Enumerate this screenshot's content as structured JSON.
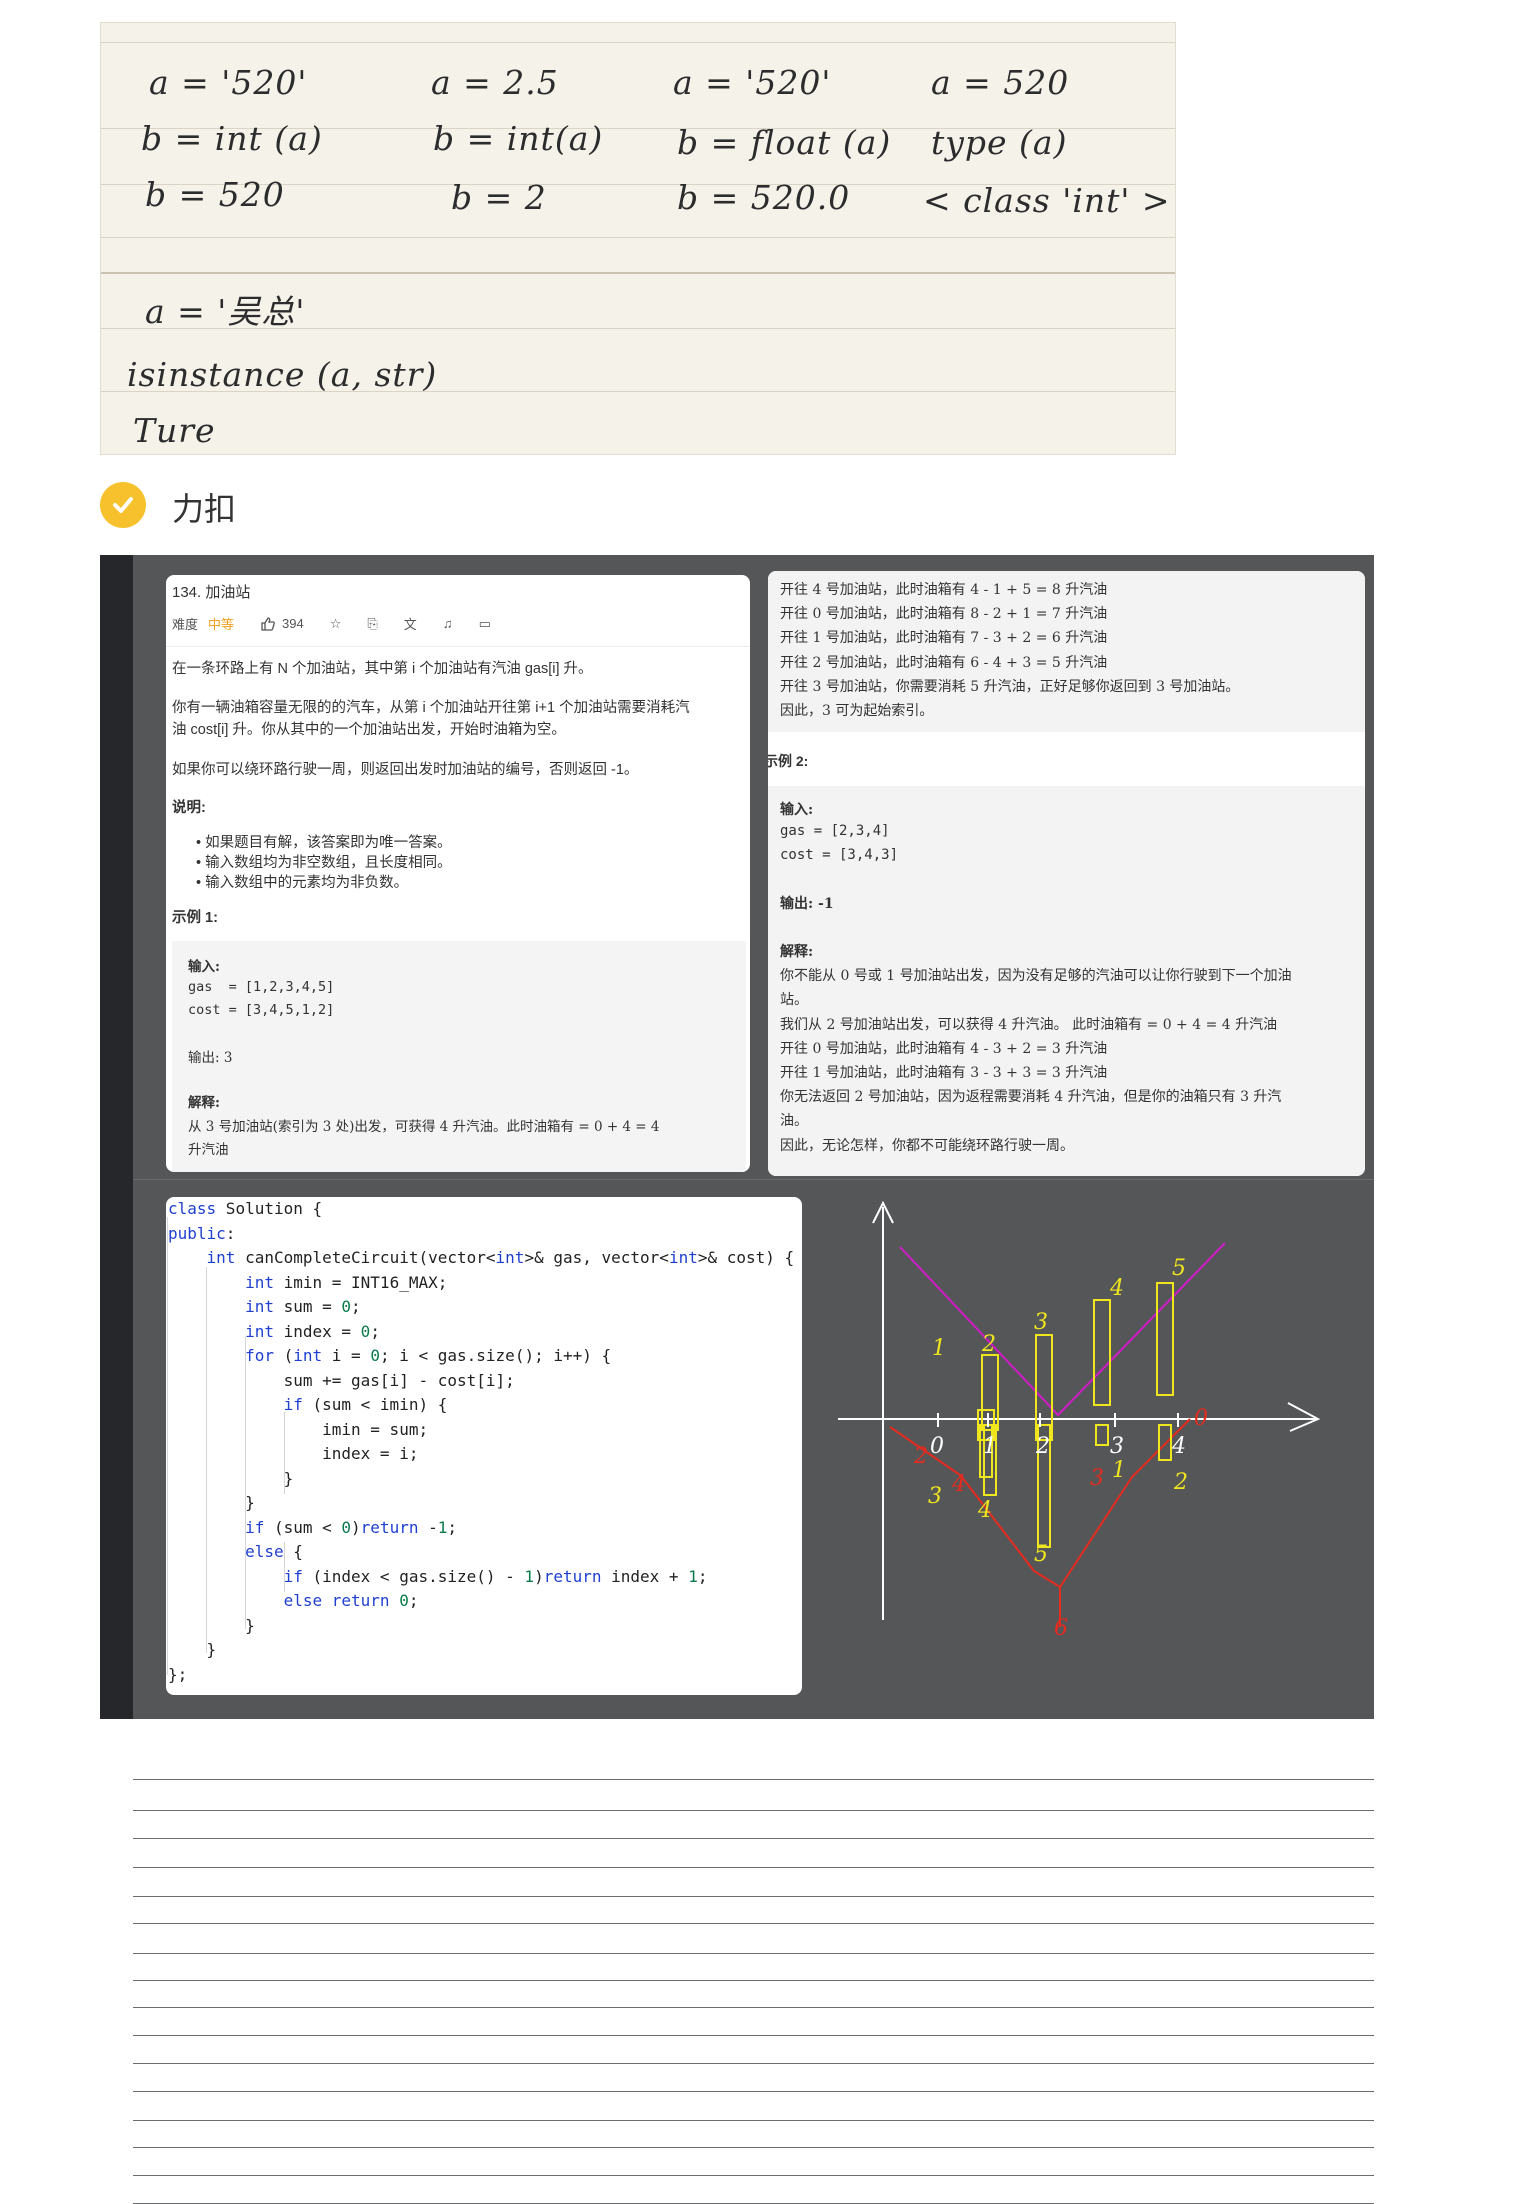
{
  "note": {
    "columns": [
      {
        "l1": "a = '520'",
        "l2": "b = int (a)",
        "l3": "b = 520"
      },
      {
        "l1": "a = 2.5",
        "l2": "b = int(a)",
        "l3": "b = 2"
      },
      {
        "l1": "a = '520'",
        "l2": "b = float (a)",
        "l3": "b = 520.0"
      },
      {
        "l1": "a = 520",
        "l2": "type (a)",
        "l3": "< class 'int' >"
      }
    ],
    "lower": {
      "l1": "a = '吴总'",
      "l2": "isinstance (a, str)",
      "l3": "Ture"
    }
  },
  "section": {
    "title": "力扣"
  },
  "problem": {
    "title": "134. 加油站",
    "difficulty_label": "难度",
    "difficulty_value": "中等",
    "likes": "394",
    "p1": "在一条环路上有 N 个加油站，其中第 i 个加油站有汽油 gas[i] 升。",
    "p2a": "你有一辆油箱容量无限的的汽车，从第 i 个加油站开往第 i+1 个加油站需要消耗汽",
    "p2b": "油 cost[i] 升。你从其中的一个加油站出发，开始时油箱为空。",
    "p3": "如果你可以绕环路行驶一周，则返回出发时加油站的编号，否则返回 -1。",
    "notes_title": "说明:",
    "notes": [
      "如果题目有解，该答案即为唯一答案。",
      "输入数组均为非空数组，且长度相同。",
      "输入数组中的元素均为非负数。"
    ],
    "ex1_title": "示例 1:",
    "ex1_input_label": "输入:",
    "ex1_gas": "gas  = [1,2,3,4,5]",
    "ex1_cost": "cost = [3,4,5,1,2]",
    "ex1_output": "输出: 3",
    "ex1_expl_label": "解释:",
    "ex1_expl_a": "从 3 号加油站(索引为 3 处)出发，可获得 4 升汽油。此时油箱有 = 0 + 4 = 4",
    "ex1_expl_b": "升汽油"
  },
  "explanation": {
    "lines1": [
      "开往 4 号加油站，此时油箱有 4 - 1 + 5 = 8 升汽油",
      "开往 0 号加油站，此时油箱有 8 - 2 + 1 = 7 升汽油",
      "开往 1 号加油站，此时油箱有 7 - 3 + 2 = 6 升汽油",
      "开往 2 号加油站，此时油箱有 6 - 4 + 3 = 5 升汽油",
      "开往 3 号加油站，你需要消耗 5 升汽油，正好足够你返回到 3 号加油站。",
      "因此，3 可为起始索引。"
    ],
    "ex2_title": "示例 2:",
    "ex2_input_label": "输入:",
    "ex2_gas": "gas  = [2,3,4]",
    "ex2_cost": "cost = [3,4,3]",
    "ex2_output": "输出: -1",
    "ex2_expl_label": "解释:",
    "lines2": [
      "你不能从 0 号或 1 号加油站出发，因为没有足够的汽油可以让你行驶到下一个加油",
      "站。",
      "我们从 2 号加油站出发，可以获得 4 升汽油。 此时油箱有 = 0 + 4 = 4 升汽油",
      "开往 0 号加油站，此时油箱有 4 - 3 + 2 = 3 升汽油",
      "开往 1 号加油站，此时油箱有 3 - 3 + 3 = 3 升汽油",
      "你无法返回 2 号加油站，因为返程需要消耗 4 升汽油，但是你的油箱只有 3 升汽",
      "油。",
      "因此，无论怎样，你都不可能绕环路行驶一周。"
    ]
  },
  "code": {
    "lines": [
      "class Solution {",
      "public:",
      "    int canCompleteCircuit(vector<int>& gas, vector<int>& cost) {",
      "        int imin = INT16_MAX;",
      "        int sum = 0;",
      "        int index = 0;",
      "        for (int i = 0; i < gas.size(); i++) {",
      "            sum += gas[i] - cost[i];",
      "            if (sum < imin) {",
      "                imin = sum;",
      "                index = i;",
      "            }",
      "        }",
      "        if (sum < 0)return -1;",
      "        else {",
      "            if (index < gas.size() - 1)return index + 1;",
      "            else return 0;",
      "        }",
      "    }",
      "};"
    ]
  },
  "sketch": {
    "x_labels": [
      "0",
      "1",
      "2",
      "3",
      "4"
    ],
    "gas_labels": [
      "1",
      "2",
      "3",
      "4",
      "5"
    ],
    "cost_labels": [
      "3",
      "4",
      "5",
      "1",
      "2"
    ],
    "red_labels": [
      "2",
      "4",
      "6",
      "3",
      "0"
    ],
    "colors": {
      "magenta": "#d21ac8",
      "red": "#e52a1e",
      "yellow": "#f0e61e",
      "axis": "#ffffff"
    }
  }
}
